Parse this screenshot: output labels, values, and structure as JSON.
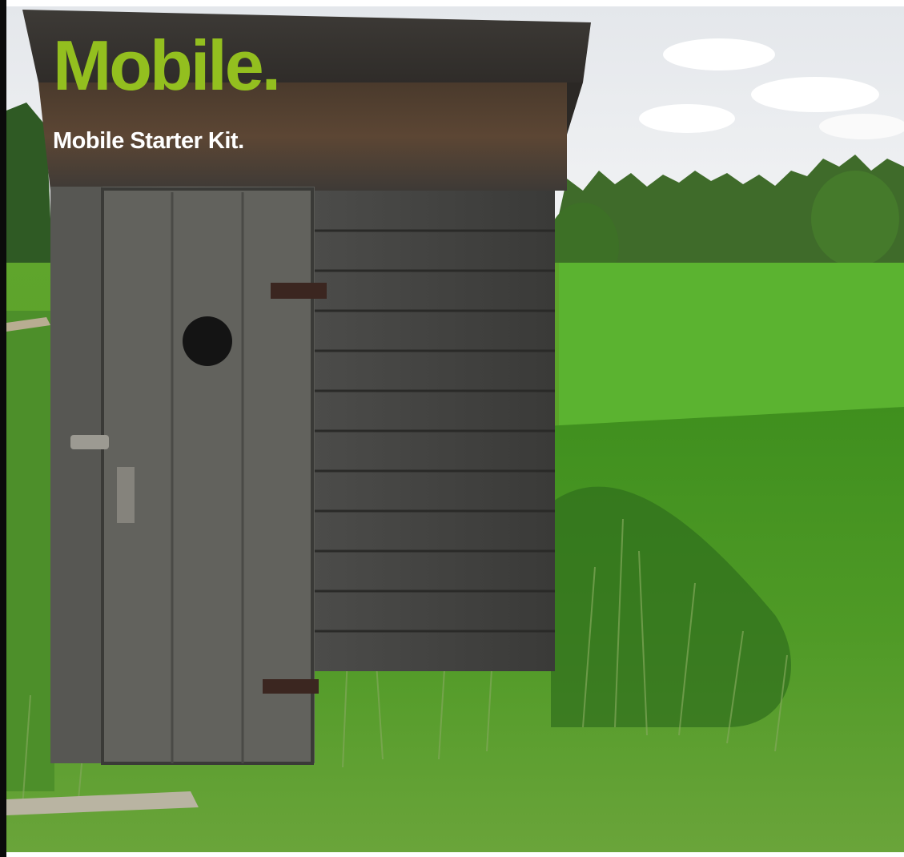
{
  "hero": {
    "title": "Mobile.",
    "subtitle": "Mobile Starter Kit.",
    "title_color": "#93bf1f",
    "subtitle_color": "#ffffff"
  },
  "photo": {
    "subject": "weathered wooden outhouse in a green grass field"
  }
}
